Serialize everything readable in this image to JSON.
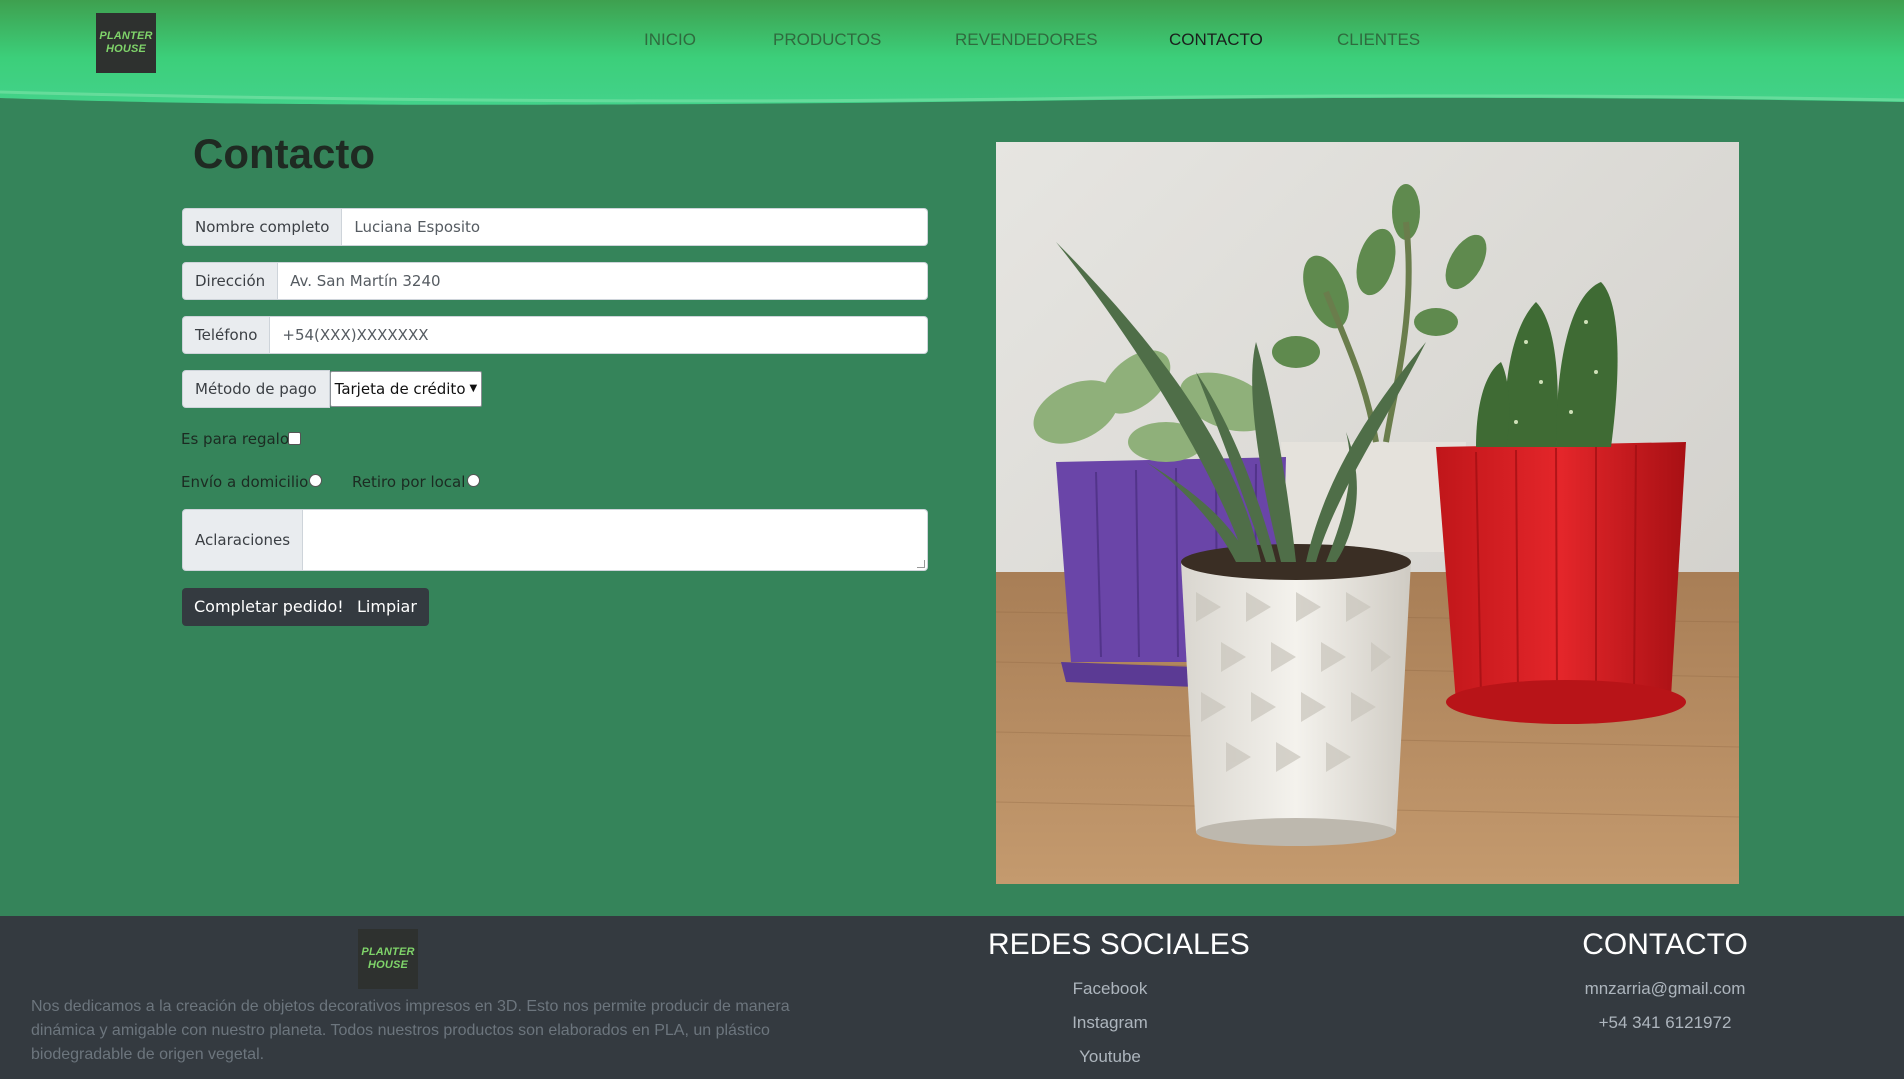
{
  "brand": {
    "logo_line1": "PLANTER",
    "logo_line2": "HOUSE"
  },
  "nav": {
    "items": [
      {
        "label": "INICIO",
        "active": false
      },
      {
        "label": "PRODUCTOS",
        "active": false
      },
      {
        "label": "REVENDEDORES",
        "active": false
      },
      {
        "label": "CONTACTO",
        "active": true
      },
      {
        "label": "CLIENTES",
        "active": false
      }
    ]
  },
  "form": {
    "title": "Contacto",
    "name": {
      "label": "Nombre completo",
      "value": "Luciana Esposito"
    },
    "address": {
      "label": "Dirección",
      "value": "Av. San Martín 3240"
    },
    "phone": {
      "label": "Teléfono",
      "value": "+54(XXX)XXXXXXX"
    },
    "payment": {
      "label": "Método de pago",
      "selected": "Tarjeta de crédito"
    },
    "gift": {
      "label": "Es para regalo",
      "checked": false
    },
    "delivery": {
      "label": "Envío a domicilio",
      "checked": false
    },
    "pickup": {
      "label": "Retiro por local",
      "checked": false
    },
    "notes": {
      "label": "Aclaraciones",
      "value": ""
    },
    "submit_label": "Completar pedido!",
    "reset_label": "Limpiar"
  },
  "photo": {
    "subject": "potted-succulents-photo"
  },
  "footer": {
    "about": "Nos dedicamos a la creación de objetos decorativos impresos en 3D. Esto nos permite producir de manera dinámica y amigable con nuestro planeta. Todos nuestros productos son elaborados en PLA, un plástico biodegradable de origen vegetal.",
    "social_title": "REDES SOCIALES",
    "social_links": [
      "Facebook",
      "Instagram",
      "Youtube"
    ],
    "contact_title": "CONTACTO",
    "email": "mnzarria@gmail.com",
    "phone": "+54 341 6121972"
  },
  "colors": {
    "body": "#35845a",
    "header_light": "#41c97f",
    "footer": "#343a40"
  }
}
